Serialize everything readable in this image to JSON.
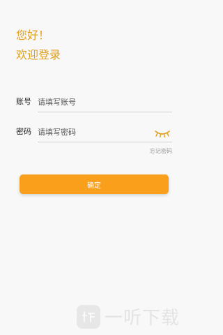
{
  "greeting": {
    "line1": "您好！",
    "line2": "欢迎登录"
  },
  "form": {
    "account": {
      "label": "账号",
      "placeholder": "请填写账号"
    },
    "password": {
      "label": "密码",
      "placeholder": "请填写密码"
    },
    "forgot_link": "忘记密码",
    "confirm_label": "确定"
  },
  "icons": {
    "password_toggle": "eye-closed-icon"
  },
  "watermark": {
    "text": "一听下载"
  },
  "colors": {
    "accent": "#f99f1b",
    "greeting": "#e0a01c",
    "background": "#f8f8f8"
  }
}
